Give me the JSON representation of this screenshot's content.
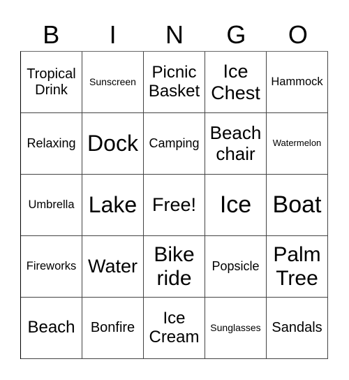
{
  "header": {
    "letters": [
      "B",
      "I",
      "N",
      "G",
      "O"
    ]
  },
  "cells": [
    [
      "Tropical Drink",
      "Sunscreen",
      "Picnic Basket",
      "Ice Chest",
      "Hammock"
    ],
    [
      "Relaxing",
      "Dock",
      "Camping",
      "Beach chair",
      "Watermelon"
    ],
    [
      "Umbrella",
      "Lake",
      "Free!",
      "Ice",
      "Boat"
    ],
    [
      "Fireworks",
      "Water",
      "Bike ride",
      "Popsicle",
      "Palm Tree"
    ],
    [
      "Beach",
      "Bonfire",
      "Ice Cream",
      "Sunglasses",
      "Sandals"
    ]
  ]
}
